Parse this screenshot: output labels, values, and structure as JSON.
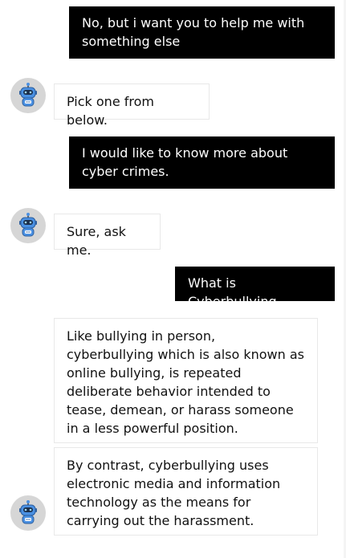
{
  "conversation": {
    "messages": [
      {
        "sender": "user",
        "text": "No, but i want you to help me with something else"
      },
      {
        "sender": "bot",
        "text": "Pick one from below."
      },
      {
        "sender": "user",
        "text": "I would like to know more about cyber crimes."
      },
      {
        "sender": "bot",
        "text": "Sure, ask me."
      },
      {
        "sender": "user",
        "text": "What is Cyberbullying"
      },
      {
        "sender": "bot",
        "text": "Like bullying in person, cyberbullying which is also known as online bullying, is repeated deliberate behavior intended to tease, demean, or harass someone in a less powerful position."
      },
      {
        "sender": "bot",
        "text": "By contrast, cyberbullying uses electronic media and information technology as the means for carrying out the harassment."
      }
    ]
  },
  "icons": {
    "bot_avatar": "robot-avatar-icon"
  },
  "colors": {
    "user_bubble": "#000000",
    "user_text": "#ffffff",
    "bot_bubble": "#ffffff",
    "bot_border": "#e8e8e8",
    "avatar_bg": "#d6d6d6",
    "robot_blue": "#4a90e2"
  }
}
